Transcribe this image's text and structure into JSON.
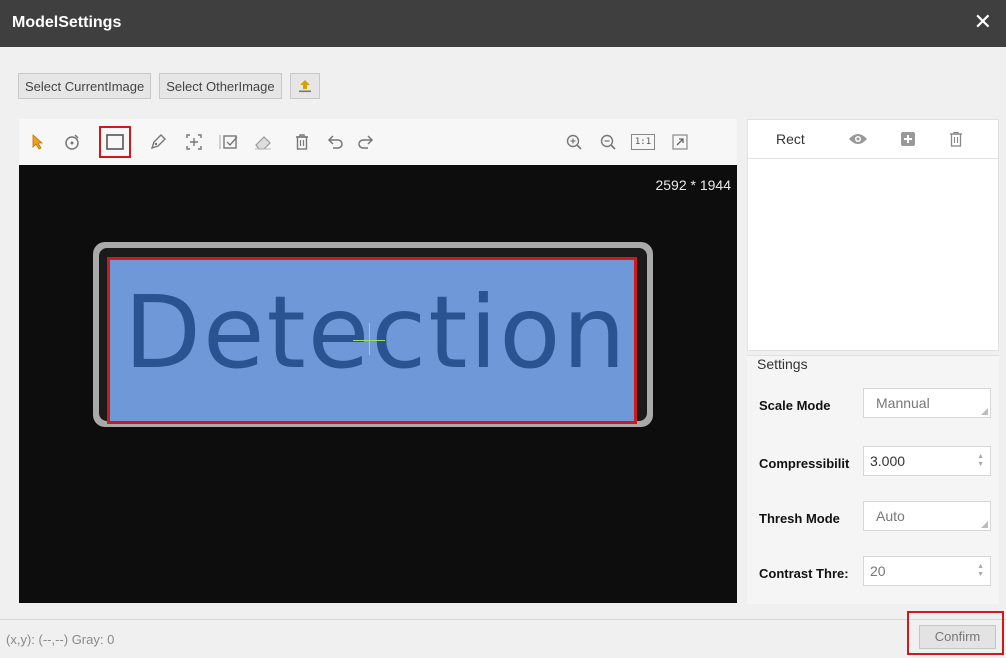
{
  "window": {
    "title": "ModelSettings",
    "close_glyph": "✕"
  },
  "top_buttons": {
    "select_current": "Select CurrentImage",
    "select_other": "Select OtherImage",
    "upload_icon": "upload-icon"
  },
  "toolbar": {
    "tools": [
      "pointer-icon",
      "ellipse-icon",
      "rectangle-icon",
      "pen-icon",
      "crosshair-icon",
      "checkbox-icon",
      "eraser-icon",
      "trash-icon",
      "undo-icon",
      "redo-icon"
    ],
    "view_tools": [
      "zoom-in-icon",
      "zoom-out-icon",
      "actual-size-icon",
      "fit-icon"
    ],
    "actual_size_label": "1:1"
  },
  "canvas": {
    "image_size": "2592 * 1944",
    "roi_text": "Detection"
  },
  "rect_panel": {
    "label": "Rect"
  },
  "settings": {
    "title": "Settings",
    "scale_mode": {
      "label": "Scale Mode",
      "value": "Mannual"
    },
    "compressibility": {
      "label": "Compressibilit",
      "value": "3.000"
    },
    "thresh_mode": {
      "label": "Thresh Mode",
      "value": "Auto"
    },
    "contrast_thresh": {
      "label": "Contrast Thre:",
      "value": "20"
    }
  },
  "status": {
    "text": "(x,y): (--,--) Gray: 0"
  },
  "confirm_label": "Confirm",
  "colors": {
    "accent_red": "#d01a1a",
    "roi_blue": "#6f98d8",
    "titlebar": "#3f3f3f"
  }
}
